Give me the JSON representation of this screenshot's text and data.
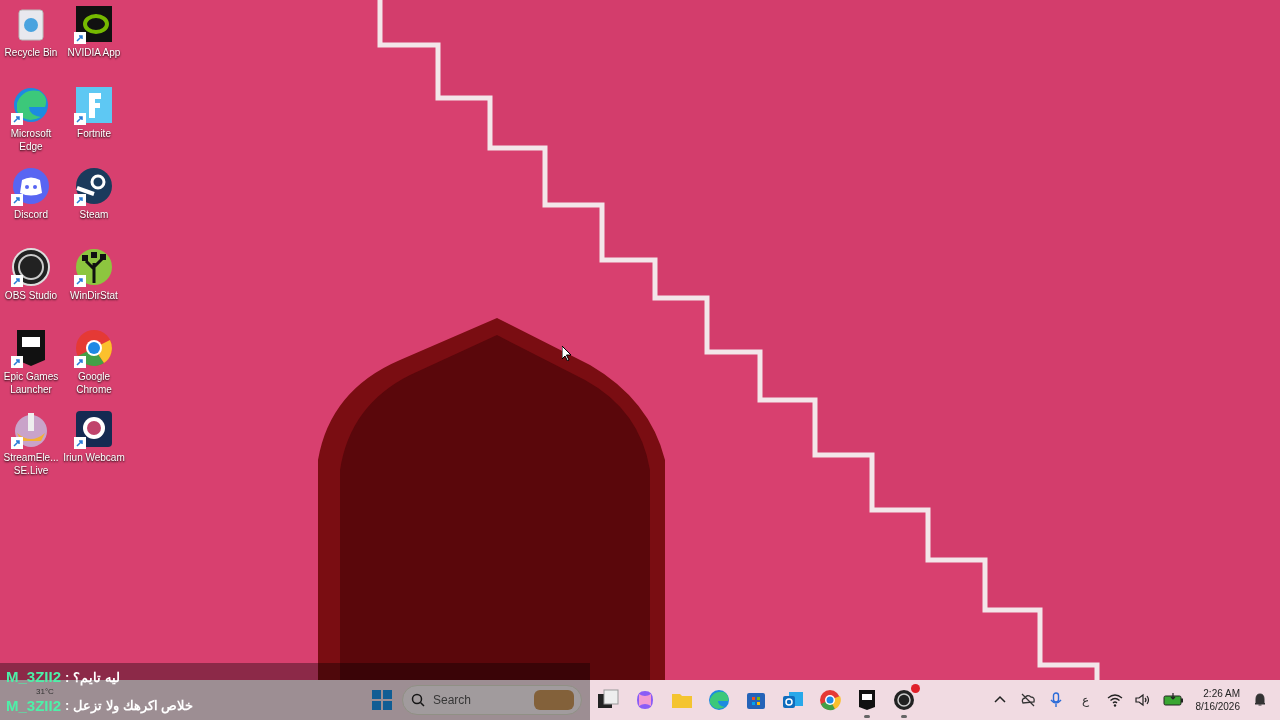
{
  "desktop_icons": [
    {
      "kind": "recycle",
      "label": "Recycle Bin",
      "shortcut": false
    },
    {
      "kind": "nvidia",
      "label": "NVIDIA App",
      "shortcut": true
    },
    {
      "kind": "edge",
      "label": "Microsoft Edge",
      "shortcut": true
    },
    {
      "kind": "fortnite",
      "label": "Fortnite",
      "shortcut": true
    },
    {
      "kind": "discord",
      "label": "Discord",
      "shortcut": true
    },
    {
      "kind": "steam",
      "label": "Steam",
      "shortcut": true
    },
    {
      "kind": "obs",
      "label": "OBS Studio",
      "shortcut": true
    },
    {
      "kind": "windirstat",
      "label": "WinDirStat",
      "shortcut": true
    },
    {
      "kind": "epic",
      "label": "Epic Games Launcher",
      "shortcut": true
    },
    {
      "kind": "chrome",
      "label": "Google Chrome",
      "shortcut": true
    },
    {
      "kind": "streamelements",
      "label": "StreamEle... SE.Live",
      "shortcut": true
    },
    {
      "kind": "iriun",
      "label": "Iriun Webcam",
      "shortcut": true
    }
  ],
  "chat_overlay": [
    {
      "user": "M_3ZII2",
      "separator": ":",
      "message": "ليه تايم؟"
    },
    {
      "user": "M_3ZII2",
      "separator": ":",
      "message": "خلاص اكرهك ولا تزعل"
    }
  ],
  "weather": {
    "temperature": "31°C"
  },
  "taskbar": {
    "search": {
      "placeholder": "Search"
    },
    "apps": [
      {
        "kind": "task-view",
        "running": false,
        "badge": false
      },
      {
        "kind": "copilot",
        "running": false,
        "badge": false
      },
      {
        "kind": "folder",
        "running": false,
        "badge": false
      },
      {
        "kind": "edge",
        "running": false,
        "badge": false
      },
      {
        "kind": "store",
        "running": false,
        "badge": false
      },
      {
        "kind": "outlook",
        "running": false,
        "badge": false
      },
      {
        "kind": "chrome",
        "running": false,
        "badge": false
      },
      {
        "kind": "epic",
        "running": true,
        "badge": false
      },
      {
        "kind": "obs",
        "running": true,
        "badge": true
      }
    ],
    "language": "ع",
    "time": "2:26 AM",
    "date": "8/16/2026"
  }
}
